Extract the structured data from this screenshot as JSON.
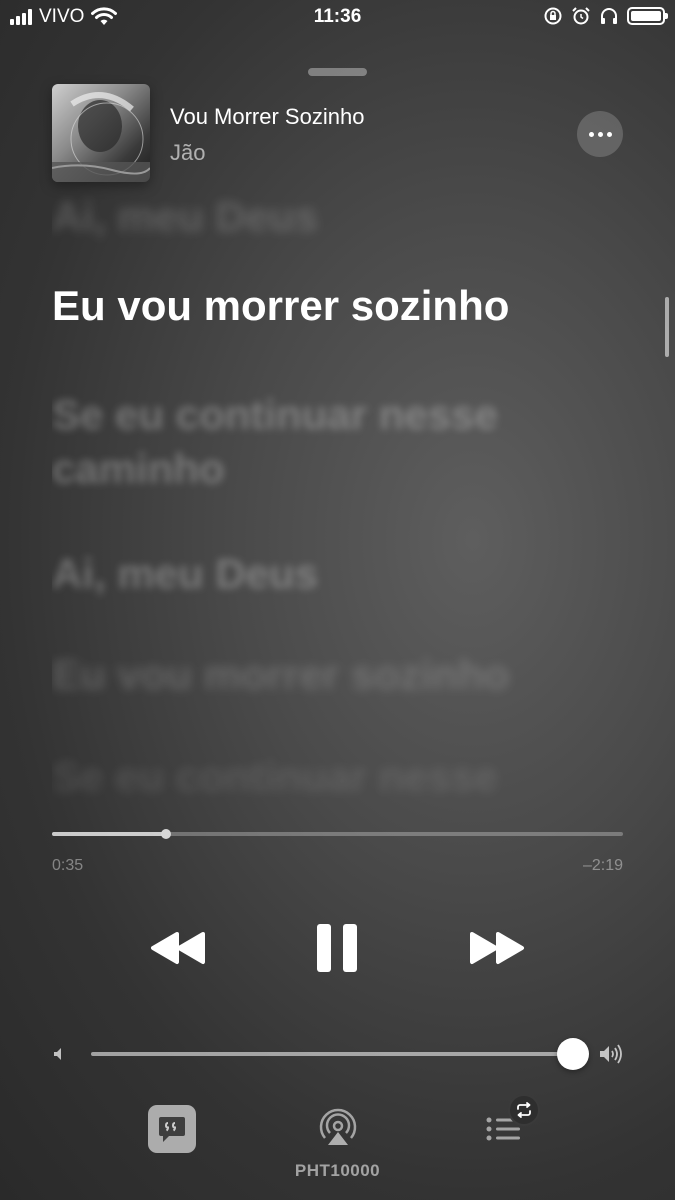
{
  "status_bar": {
    "carrier": "VIVO",
    "time": "11:36",
    "icons": [
      "signal-icon",
      "wifi-icon",
      "orientation-lock-icon",
      "alarm-icon",
      "headphones-icon",
      "battery-icon"
    ]
  },
  "now_playing": {
    "title": "Vou Morrer Sozinho",
    "artist": "Jão",
    "artwork_icon": "album-art"
  },
  "lyrics": [
    {
      "text": "Ai, meu Deus",
      "state": "past"
    },
    {
      "text": "Eu vou morrer sozinho",
      "state": "active"
    },
    {
      "text": "Se eu continuar nesse caminho",
      "state": "upcoming"
    },
    {
      "text": "Ai, meu Deus",
      "state": "upcoming"
    },
    {
      "text": "Eu vou morrer sozinho",
      "state": "upcoming"
    },
    {
      "text": "Se eu continuar nesse",
      "state": "upcoming"
    }
  ],
  "playback": {
    "elapsed": "0:35",
    "remaining": "–2:19",
    "progress_fraction": 0.2
  },
  "volume": {
    "level_fraction": 1.0
  },
  "controls": {
    "rewind_icon": "rewind-icon",
    "pause_icon": "pause-icon",
    "forward_icon": "fast-forward-icon"
  },
  "bottom_bar": {
    "device_name": "PHT10000",
    "icons": [
      "lyrics-icon",
      "airplay-icon",
      "queue-icon",
      "repeat-icon"
    ]
  },
  "colors": {
    "background": "#4a4a4a",
    "text_primary": "#ffffff",
    "text_secondary": "#9a9a9a"
  }
}
